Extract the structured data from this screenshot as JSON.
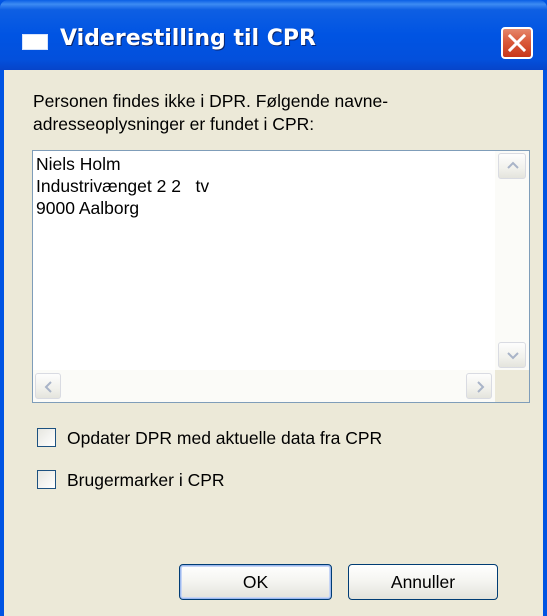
{
  "window": {
    "title": "Viderestilling til CPR"
  },
  "message": {
    "line1": "Personen findes ikke i DPR. Følgende navne-",
    "line2": "adresseoplysninger er fundet i CPR:"
  },
  "address": {
    "lines": [
      "Niels Holm",
      "Industrivænget 2 2   tv",
      "9000 Aalborg"
    ]
  },
  "options": {
    "update_label": "Opdater DPR med aktuelle data fra CPR",
    "update_checked": false,
    "mark_label": "Brugermarker i CPR",
    "mark_checked": false
  },
  "buttons": {
    "ok_label": "OK",
    "cancel_label": "Annuller"
  },
  "icons": [
    "window-icon",
    "close-icon",
    "scroll-up-icon",
    "scroll-down-icon",
    "scroll-left-icon",
    "scroll-right-icon"
  ],
  "colors": {
    "titlebar": "#0054e3",
    "close": "#da5a3b",
    "face": "#ece9d8"
  }
}
